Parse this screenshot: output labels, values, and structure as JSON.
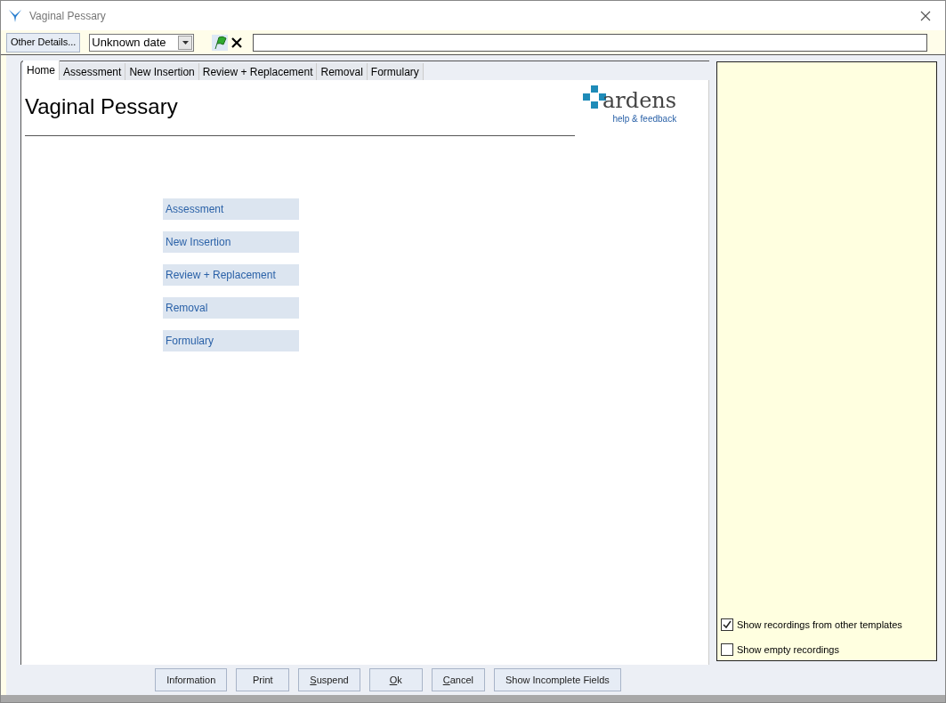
{
  "window": {
    "title": "Vaginal Pessary"
  },
  "toolbar": {
    "other_details": "Other Details...",
    "date": "Unknown date"
  },
  "tabs": [
    {
      "label": "Home",
      "selected": true
    },
    {
      "label": "Assessment",
      "selected": false
    },
    {
      "label": "New Insertion",
      "selected": false
    },
    {
      "label": "Review + Replacement",
      "selected": false
    },
    {
      "label": "Removal",
      "selected": false
    },
    {
      "label": "Formulary",
      "selected": false
    }
  ],
  "page": {
    "heading": "Vaginal Pessary",
    "logo": {
      "name": "ardens",
      "link": "help & feedback"
    },
    "links": [
      "Assessment",
      "New Insertion",
      "Review + Replacement",
      "Removal",
      "Formulary"
    ]
  },
  "side_panel": {
    "options": [
      {
        "label": "Show recordings from other templates",
        "checked": true
      },
      {
        "label": "Show empty recordings",
        "checked": false
      }
    ]
  },
  "buttons": [
    {
      "label": "Information",
      "underline_first": false
    },
    {
      "label": "Print",
      "underline_first": false
    },
    {
      "label": "Suspend",
      "underline_first": true
    },
    {
      "label": "Ok",
      "underline_first": true
    },
    {
      "label": "Cancel",
      "underline_first": true
    },
    {
      "label": "Show Incomplete Fields",
      "underline_first": false
    }
  ]
}
